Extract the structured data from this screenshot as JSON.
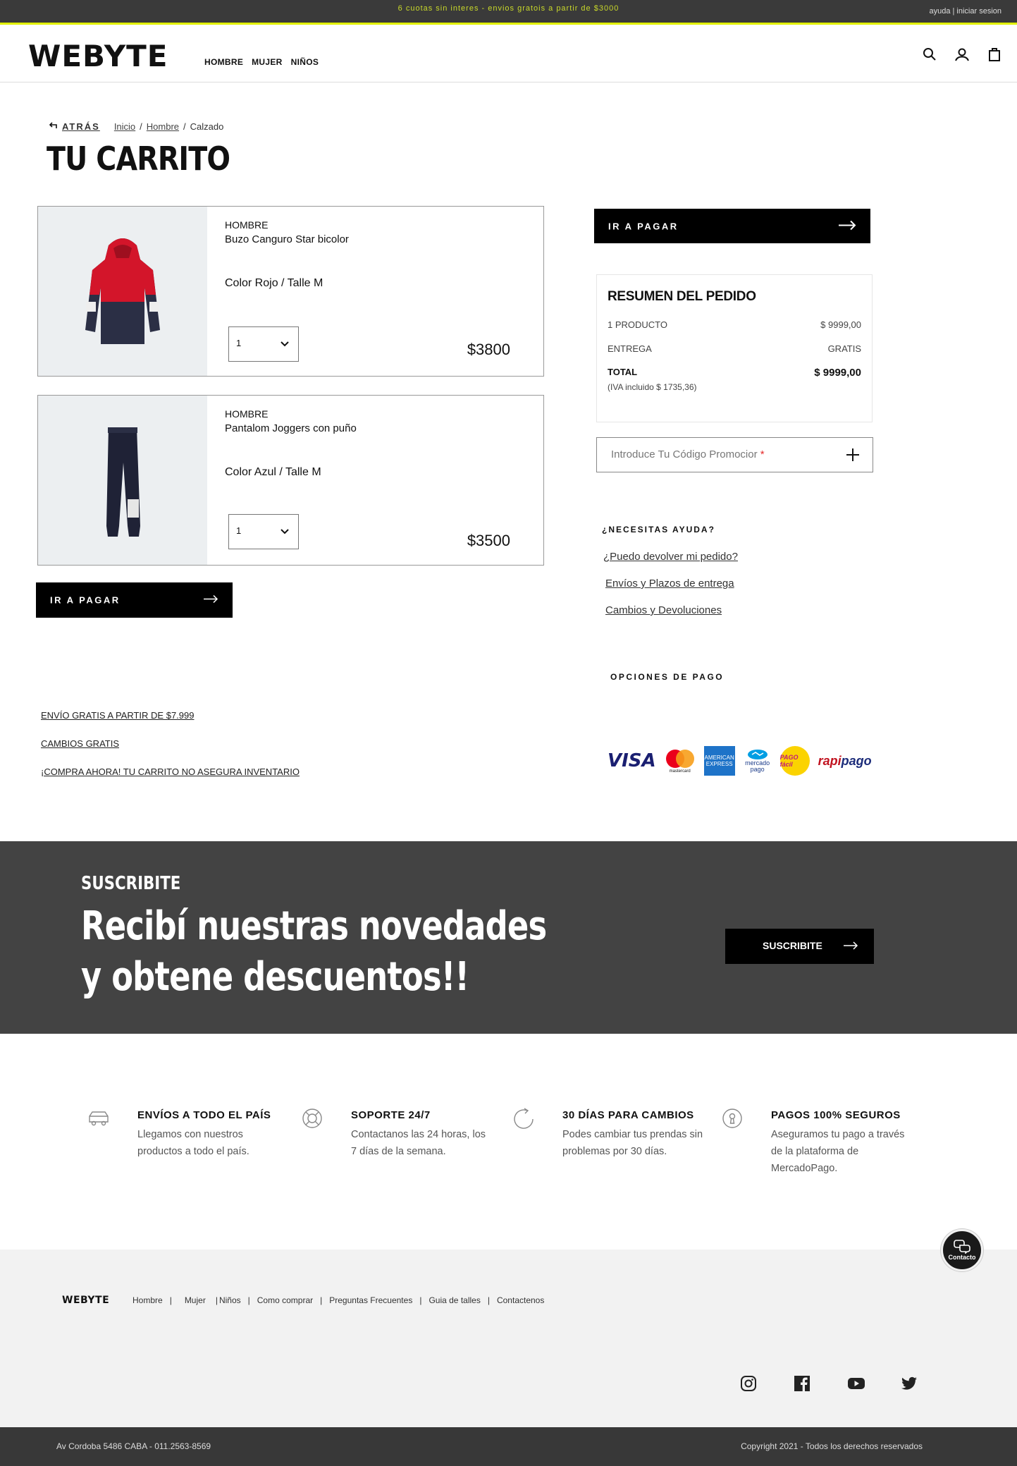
{
  "topbar": {
    "promo": "6 cuotas sin interes - envios gratois a partir de $3000",
    "account": "ayuda | iniciar sesion"
  },
  "header": {
    "logo": "WEBYTE",
    "nav": [
      "HOMBRE",
      "MUJER",
      "NIÑOS"
    ],
    "icons": [
      "search-icon",
      "user-icon",
      "bag-icon"
    ]
  },
  "breadcrumb": {
    "back": "ATRÁS",
    "items": [
      "Inicio",
      "Hombre",
      "Calzado"
    ],
    "separator": "/"
  },
  "page_title": "TU CARRITO",
  "cart": {
    "items": [
      {
        "category": "HOMBRE",
        "name": "Buzo Canguro Star bicolor",
        "variant": "Color Rojo  /  Talle  M",
        "quantity": "1",
        "price": "$3800"
      },
      {
        "category": "HOMBRE",
        "name": "Pantalom Joggers con puño",
        "variant": "Color Azul /  Talle  M",
        "quantity": "1",
        "price": "$3500"
      }
    ],
    "checkout_label": "IR A PAGAR"
  },
  "summary": {
    "checkout_label": "IR A PAGAR",
    "title": "RESUMEN DEL PEDIDO",
    "rows": [
      {
        "label": "1 PRODUCTO",
        "value": "$ 9999,00"
      },
      {
        "label": "ENTREGA",
        "value": "GRATIS"
      },
      {
        "label": "TOTAL",
        "value": "$ 9999,00"
      }
    ],
    "iva": "(IVA incluido  $ 1735,36)",
    "promo_placeholder": "Introduce Tu Código Promocior",
    "promo_required": "*"
  },
  "help": {
    "title": "¿NECESITAS AYUDA?",
    "links": [
      "¿Puedo devolver mi pedido?",
      "Envíos y Plazos de entrega",
      "Cambios y Devoluciones"
    ]
  },
  "payment": {
    "title": "OPCIONES DE PAGO",
    "logos": {
      "visa": "VISA",
      "mastercard": "mastercard",
      "amex": "AMERICAN EXPRESS",
      "mercadopago_top": "mercado",
      "mercadopago_bottom": "pago",
      "pagofacil": "PAGO fácil",
      "rapipago_a": "rapi",
      "rapipago_b": "pago"
    }
  },
  "perks": [
    "ENVÍO GRATIS A PARTIR DE $7.999",
    "CAMBIOS GRATIS",
    "¡COMPRA AHORA! TU CARRITO NO ASEGURA INVENTARIO"
  ],
  "subscribe": {
    "kicker": "SUSCRIBITE",
    "line1": "Recibí nuestras novedades",
    "line2": "y obtene descuentos!!",
    "button": "SUSCRIBITE"
  },
  "features": [
    {
      "icon": "truck-icon",
      "title": "ENVÍOS A TODO EL PAÍS",
      "desc": "Llegamos con nuestros productos a todo el país."
    },
    {
      "icon": "lifebuoy-icon",
      "title": "SOPORTE 24/7",
      "desc": "Contactanos las 24 horas, los 7 días de la semana."
    },
    {
      "icon": "refresh-icon",
      "title": "30 DÍAS PARA CAMBIOS",
      "desc": "Podes cambiar tus prendas sin problemas por 30 días."
    },
    {
      "icon": "keyhole-icon",
      "title": "PAGOS 100% SEGUROS",
      "desc": "Aseguramos tu pago a través de la plataforma de MercadoPago."
    }
  ],
  "footer": {
    "logo": "WEBYTE",
    "links": [
      "Hombre",
      "Mujer",
      "Niños",
      "Como comprar",
      "Preguntas Frecuentes",
      "Guia de talles",
      "Contactenos"
    ],
    "social": [
      "instagram-icon",
      "facebook-icon",
      "youtube-icon",
      "twitter-icon"
    ],
    "chat": "Contacto",
    "address": "Av Cordoba 5486 CABA - 011.2563-8569",
    "copyright": "Copyright 2021 - Todos los derechos reservados"
  }
}
